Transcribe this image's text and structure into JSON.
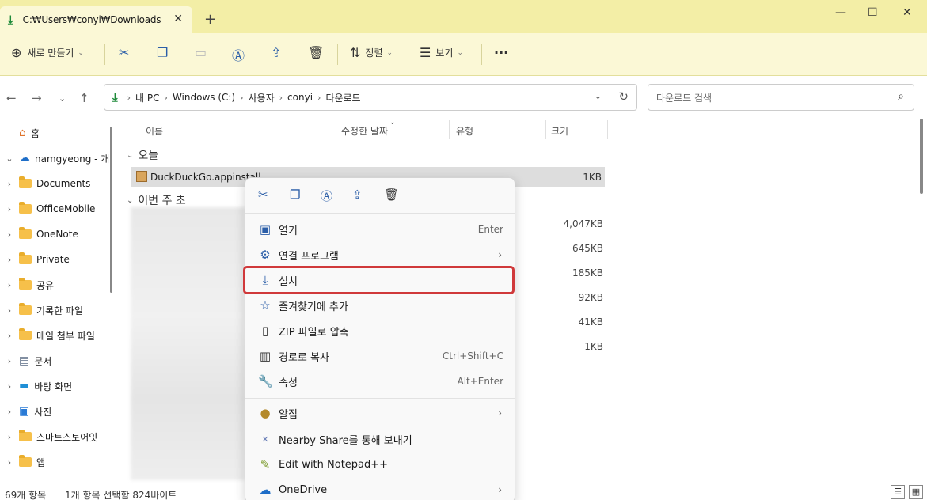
{
  "titlebar": {
    "tab_title": "C:₩Users₩conyi₩Downloads",
    "new_tab": "+",
    "minimize": "—",
    "maximize": "☐",
    "close": "✕",
    "tab_close": "✕"
  },
  "commandbar": {
    "new_label": "새로 만들기",
    "sort_label": "정렬",
    "view_label": "보기",
    "more": "···"
  },
  "address": {
    "crumbs": [
      "내 PC",
      "Windows (C:)",
      "사용자",
      "conyi",
      "다운로드"
    ],
    "search_placeholder": "다운로드 검색"
  },
  "sidebar": {
    "items": [
      {
        "label": "홈"
      },
      {
        "label": "namgyeong - 개"
      },
      {
        "label": "Documents"
      },
      {
        "label": "OfficeMobile"
      },
      {
        "label": "OneNote"
      },
      {
        "label": "Private"
      },
      {
        "label": "공유"
      },
      {
        "label": "기록한 파일"
      },
      {
        "label": "메일 첨부 파일"
      },
      {
        "label": "문서"
      },
      {
        "label": "바탕 화면"
      },
      {
        "label": "사진"
      },
      {
        "label": "스마트스토어잇"
      },
      {
        "label": "앱"
      }
    ]
  },
  "columns": {
    "name": "이름",
    "modified": "수정한 날짜",
    "type": "유형",
    "size": "크기"
  },
  "groups": {
    "today": "오늘",
    "this_week": "이번 주 초"
  },
  "files": {
    "selected_name": "DuckDuckGo.appinstall",
    "selected_size": "1KB",
    "sizes": [
      "4,047KB",
      "645KB",
      "185KB",
      "92KB",
      "41KB",
      "1KB"
    ]
  },
  "context_menu": {
    "items": [
      {
        "label": "열기",
        "shortcut": "Enter"
      },
      {
        "label": "연결 프로그램"
      },
      {
        "label": "설치"
      },
      {
        "label": "즐겨찾기에 추가"
      },
      {
        "label": "ZIP 파일로 압축"
      },
      {
        "label": "경로로 복사",
        "shortcut": "Ctrl+Shift+C"
      },
      {
        "label": "속성",
        "shortcut": "Alt+Enter"
      },
      {
        "label": "알집"
      },
      {
        "label": "Nearby Share를 통해 보내기"
      },
      {
        "label": "Edit with Notepad++"
      },
      {
        "label": "OneDrive"
      }
    ]
  },
  "status": {
    "count": "69개 항목",
    "selection": "1개 항목 선택함 824바이트"
  },
  "colors": {
    "title_bg": "#f3eea6",
    "toolbar_bg": "#fbf8d6",
    "highlight": "#d0393b",
    "accent": "#2b5ea8"
  }
}
